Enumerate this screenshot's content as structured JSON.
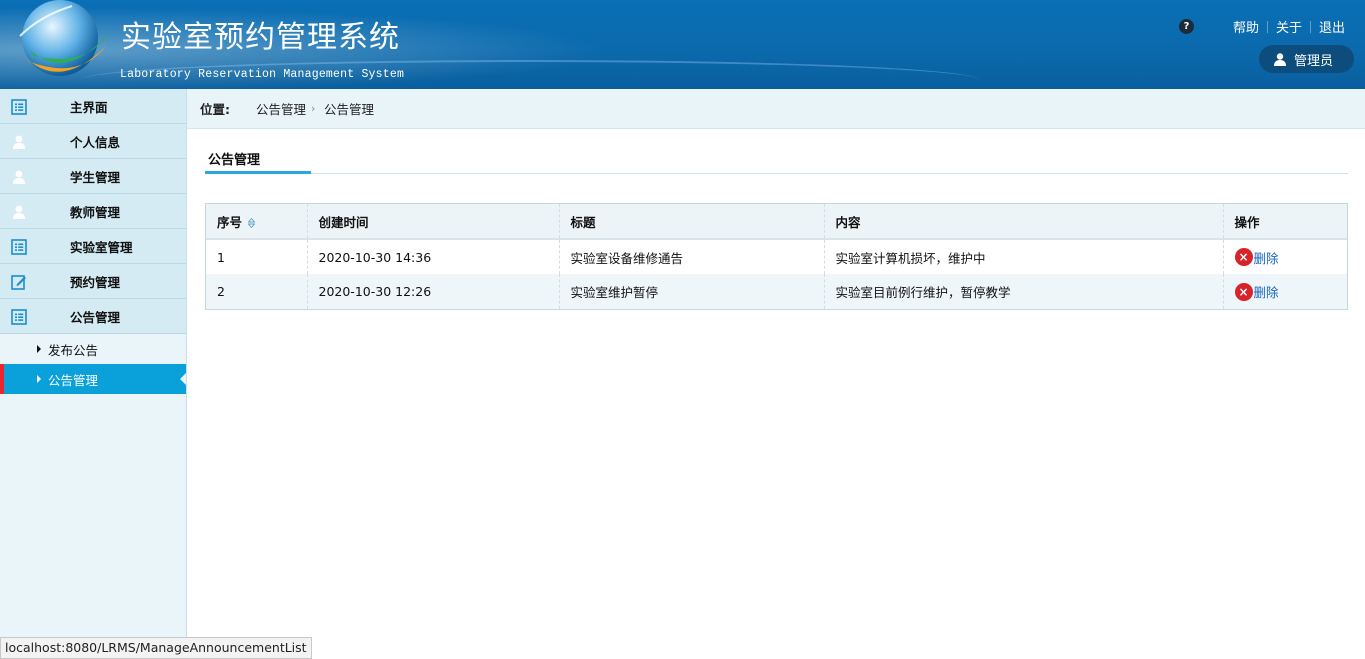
{
  "header": {
    "title": "实验室预约管理系统",
    "subtitle": "Laboratory Reservation Management System",
    "help_icon_text": "?",
    "links": [
      "帮助",
      "关于",
      "退出"
    ],
    "user": "管理员"
  },
  "sidebar": {
    "items": [
      {
        "label": "主界面",
        "icon": "list-icon"
      },
      {
        "label": "个人信息",
        "icon": "user-icon"
      },
      {
        "label": "学生管理",
        "icon": "user-icon"
      },
      {
        "label": "教师管理",
        "icon": "user-icon"
      },
      {
        "label": "实验室管理",
        "icon": "list-icon"
      },
      {
        "label": "预约管理",
        "icon": "edit-icon"
      },
      {
        "label": "公告管理",
        "icon": "list-icon"
      }
    ],
    "subitems": [
      {
        "label": "发布公告",
        "active": false
      },
      {
        "label": "公告管理",
        "active": true
      }
    ]
  },
  "breadcrumb": {
    "label": "位置:",
    "crumbs": [
      "公告管理",
      "公告管理"
    ]
  },
  "section": {
    "title": "公告管理"
  },
  "table": {
    "headers": [
      "序号",
      "创建时间",
      "标题",
      "内容",
      "操作"
    ],
    "rows": [
      {
        "index": "1",
        "created": "2020-10-30 14:36",
        "title": "实验室设备维修通告",
        "content": "实验室计算机损坏，维护中",
        "action": "删除"
      },
      {
        "index": "2",
        "created": "2020-10-30 12:26",
        "title": "实验室维护暂停",
        "content": "实验室目前例行维护，暂停教学",
        "action": "删除"
      }
    ]
  },
  "status_bar": "localhost:8080/LRMS/ManageAnnouncementList",
  "colors": {
    "header_blue": "#0b6aad",
    "active_item": "#0aa0d9",
    "active_marker": "#e8262b",
    "delete_icon": "#d8232a",
    "tab_underline": "#2aa7dc"
  }
}
